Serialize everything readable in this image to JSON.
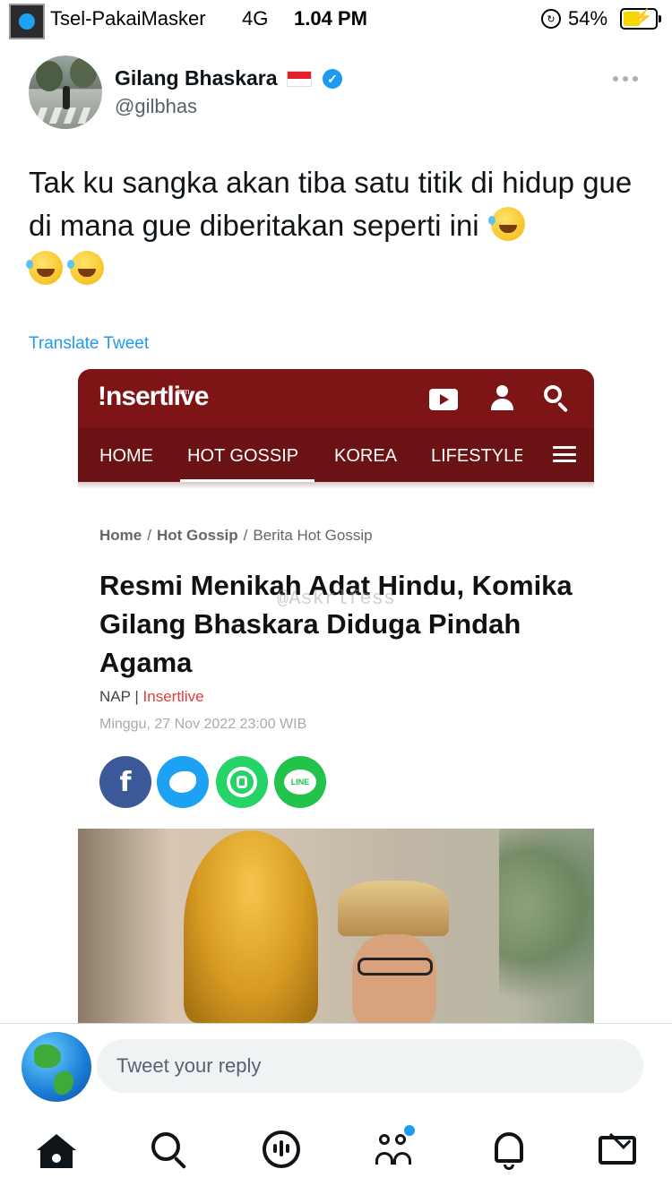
{
  "status_bar": {
    "carrier": "Tsel-PakaiMasker",
    "network": "4G",
    "time": "1.04 PM",
    "battery_percent": "54%",
    "battery_level": 0.54,
    "battery_color": "#f5d800"
  },
  "tweet": {
    "author_name": "Gilang Bhaskara",
    "author_handle": "@gilbhas",
    "verified": true,
    "flag_icon": "indonesia-flag-icon",
    "text": "Tak ku sangka akan tiba satu titik di hidup gue di mana gue diberitakan seperti ini",
    "emoji_icon": "rolling-on-floor-laughing-emoji",
    "translate_label": "Translate Tweet"
  },
  "embed": {
    "site_logo": "!nsertlive",
    "site_logo_sub": ".com",
    "nav": [
      "HOME",
      "HOT GOSSIP",
      "KOREA",
      "LIFESTYLE"
    ],
    "active_nav": "HOT GOSSIP",
    "breadcrumb": [
      "Home",
      "Hot Gossip",
      "Berita Hot Gossip"
    ],
    "headline": "Resmi Menikah Adat Hindu, Komika Gilang Bhaskara Diduga Pindah Agama",
    "watermark": "@Askrlfess",
    "author": "NAP",
    "source": "Insertlive",
    "date": "Minggu, 27 Nov 2022 23:00 WIB",
    "share": {
      "facebook": "f",
      "line": "LINE"
    },
    "header_color": "#7d1517"
  },
  "reply": {
    "placeholder": "Tweet your reply"
  },
  "tabs": [
    "home-icon",
    "search-icon",
    "spaces-icon",
    "communities-icon",
    "notifications-icon",
    "messages-icon"
  ],
  "colors": {
    "accent": "#1d9bf0",
    "text": "#0f1419",
    "secondary": "#536471"
  }
}
